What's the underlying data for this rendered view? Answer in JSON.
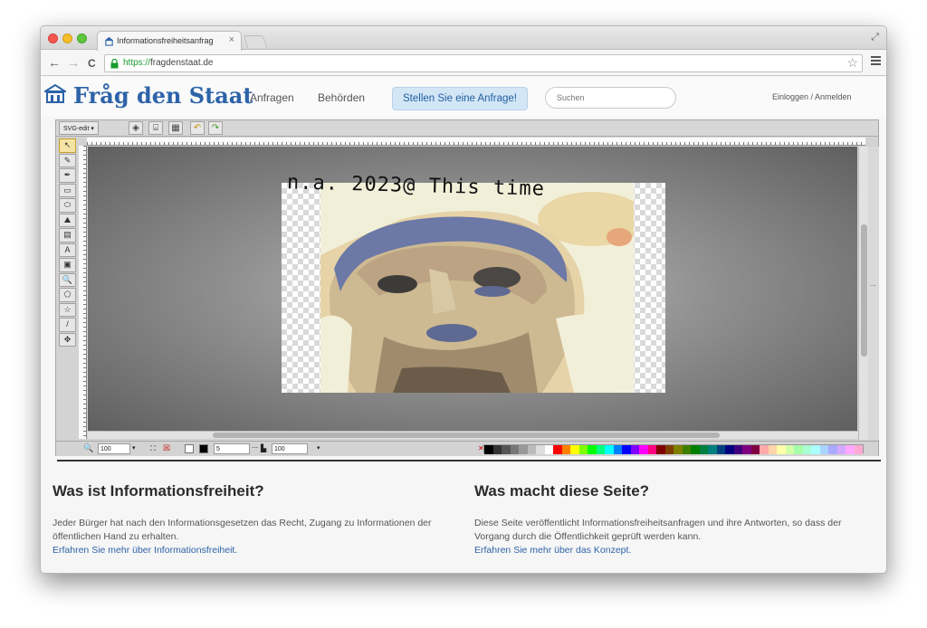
{
  "browser": {
    "tab_title": "Informationsfreiheitsanfrag",
    "tab_close": "×",
    "url_scheme": "https://",
    "url_rest": "fragdenstaat.de",
    "back": "←",
    "forward": "→",
    "reload": "C",
    "star": "☆",
    "fullscreen": "⤢"
  },
  "site": {
    "logo_text": "Fråg den Staat",
    "nav": [
      "Anfragen",
      "Behörden"
    ],
    "cta": "Stellen Sie eine Anfrage!",
    "search_placeholder": "Suchen",
    "login": "Einloggen / Anmelden"
  },
  "editor": {
    "menu_label": "SVG-edit ▾",
    "tools": [
      "↖",
      "✎",
      "✒",
      "▭",
      "⬭",
      "⛰",
      "▤",
      "A",
      "▣",
      "🔍",
      "⬠",
      "☆",
      "/",
      "✥"
    ],
    "canvas_text": "n.a. 2023@ This time",
    "zoom_value": "100",
    "stroke_width": "5",
    "opacity_value": "100",
    "palette": [
      "#000000",
      "#333333",
      "#555555",
      "#777777",
      "#999999",
      "#bbbbbb",
      "#dddddd",
      "#ffffff",
      "#ff0000",
      "#ff7f00",
      "#ffff00",
      "#7fff00",
      "#00ff00",
      "#00ff7f",
      "#00ffff",
      "#007fff",
      "#0000ff",
      "#7f00ff",
      "#ff00ff",
      "#ff007f",
      "#7f0000",
      "#7f3f00",
      "#7f7f00",
      "#3f7f00",
      "#007f00",
      "#007f3f",
      "#007f7f",
      "#003f7f",
      "#00007f",
      "#3f007f",
      "#7f007f",
      "#7f003f",
      "#ffaaaa",
      "#ffd4aa",
      "#ffffaa",
      "#d4ffaa",
      "#aaffaa",
      "#aaffd4",
      "#aaffff",
      "#aad4ff",
      "#aaaaff",
      "#d4aaff",
      "#ffaaff",
      "#ffaad4"
    ]
  },
  "info": {
    "left_title": "Was ist Informationsfreiheit?",
    "left_body": "Jeder Bürger hat nach den Informationsgesetzen das Recht, Zugang zu Informationen der öffentlichen Hand zu erhalten.",
    "left_link": "Erfahren Sie mehr über Informationsfreiheit.",
    "right_title": "Was macht diese Seite?",
    "right_body": "Diese Seite veröffentlicht Informationsfreiheitsanfragen und ihre Antworten, so dass der Vorgang durch die Öffentlichkeit geprüft werden kann.",
    "right_link": "Erfahren Sie mehr über das Konzept."
  }
}
